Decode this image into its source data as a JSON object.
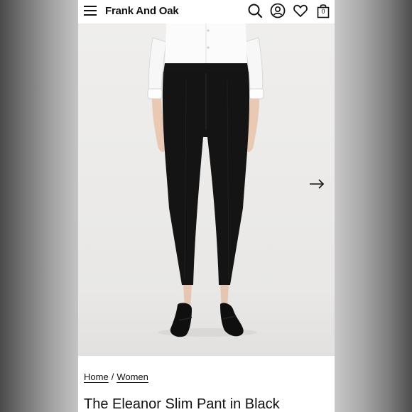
{
  "header": {
    "brand": "Frank And Oak",
    "bag_count": "0",
    "icons": [
      "menu-icon",
      "search-icon",
      "account-icon",
      "heart-icon",
      "bag-icon"
    ]
  },
  "hero": {
    "image": "product-photo",
    "next_icon": "arrow-right-icon"
  },
  "breadcrumb": {
    "items": [
      "Home",
      "Women"
    ],
    "separator": "/"
  },
  "product": {
    "title": "The Eleanor Slim Pant in Black"
  },
  "colors": {
    "background": "#ffffff",
    "text": "#111111",
    "photo_bg": "#ecebe9",
    "pants": "#141414",
    "shirt": "#fbfbfb"
  }
}
